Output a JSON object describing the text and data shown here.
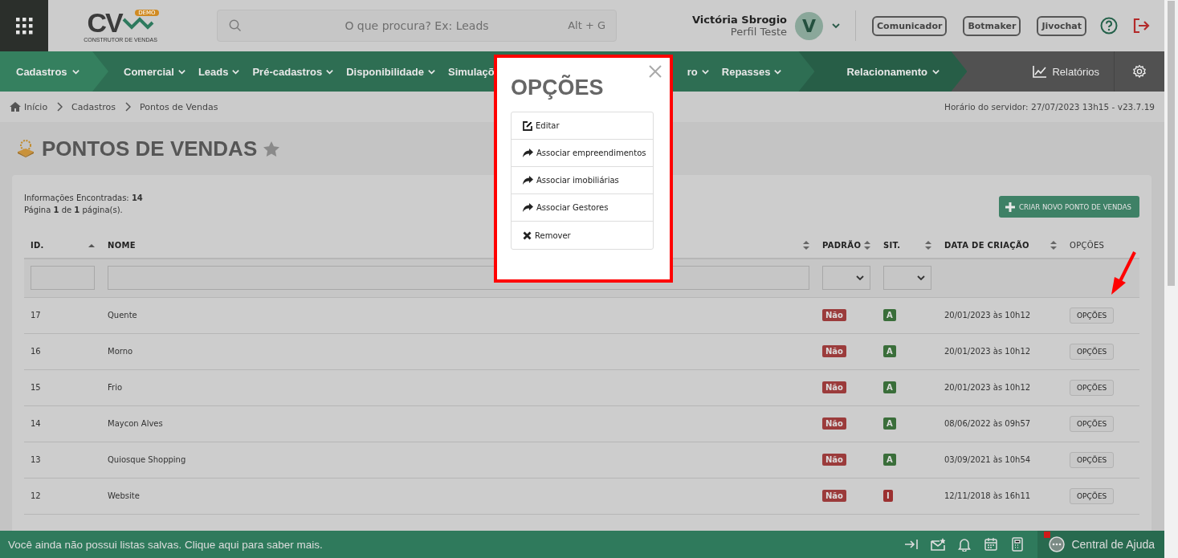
{
  "header": {
    "logo": {
      "mark": "CV",
      "badge": "DEMO",
      "tagline": "CONSTRUTOR DE VENDAS"
    },
    "search": {
      "placeholder": "O que procura? Ex: Leads",
      "shortcut": "Alt + G"
    },
    "user": {
      "name": "Victória Sbrogio",
      "profile": "Perfil Teste",
      "initial": "V"
    },
    "buttons": [
      "Comunicador",
      "Botmaker",
      "Jivochat"
    ]
  },
  "nav": {
    "items": [
      {
        "label": "Cadastros",
        "kind": "section"
      },
      {
        "label": "Comercial",
        "kind": "item"
      },
      {
        "label": "Leads",
        "kind": "item"
      },
      {
        "label": "Pré-cadastros",
        "kind": "item"
      },
      {
        "label": "Disponibilidade",
        "kind": "item"
      },
      {
        "label": "Simulaçõ",
        "kind": "covered-left"
      },
      {
        "label": "ro",
        "kind": "covered-right"
      },
      {
        "label": "Repasses",
        "kind": "item"
      },
      {
        "label": "Relacionamento",
        "kind": "section-dark"
      }
    ],
    "reports": "Relatórios"
  },
  "breadcrumb": [
    "Início",
    "Cadastros",
    "Pontos de Vendas"
  ],
  "server_time": "Horário do servidor: 27/07/2023 13h15 - v23.7.19",
  "page_title": "PONTOS DE VENDAS",
  "summary": [
    "Informações Encontradas: **14**",
    "Página **1** de **1** página(s)."
  ],
  "create_button": "CRIAR NOVO PONTO DE VENDAS",
  "table": {
    "columns": [
      {
        "label": "ID.",
        "sortable": true,
        "sorted": true
      },
      {
        "label": "NOME",
        "sortable": true,
        "sorted": false
      },
      {
        "label": "PADRÃO",
        "sortable": true,
        "sorted": false
      },
      {
        "label": "SIT.",
        "sortable": true,
        "sorted": false
      },
      {
        "label": "DATA DE CRIAÇÃO",
        "sortable": true,
        "sorted": false
      },
      {
        "label": "OPÇÕES",
        "sortable": false
      }
    ],
    "filters": [
      {
        "kind": "text"
      },
      {
        "kind": "text"
      },
      {
        "kind": "select"
      },
      {
        "kind": "select"
      },
      {
        "kind": "empty"
      },
      {
        "kind": "empty"
      }
    ],
    "rows": [
      {
        "id": "17",
        "name": "Quente",
        "default": "Não",
        "status": {
          "label": "A",
          "color": "#3a6e3a"
        },
        "created": "20/01/2023 às 10h12",
        "options": "OPÇÕES"
      },
      {
        "id": "16",
        "name": "Morno",
        "default": "Não",
        "status": {
          "label": "A",
          "color": "#3a6e3a"
        },
        "created": "20/01/2023 às 10h12",
        "options": "OPÇÕES"
      },
      {
        "id": "15",
        "name": "Frio",
        "default": "Não",
        "status": {
          "label": "A",
          "color": "#3a6e3a"
        },
        "created": "20/01/2023 às 10h12",
        "options": "OPÇÕES"
      },
      {
        "id": "14",
        "name": "Maycon Alves",
        "default": "Não",
        "status": {
          "label": "A",
          "color": "#3a6e3a"
        },
        "created": "08/06/2022 às 09h57",
        "options": "OPÇÕES"
      },
      {
        "id": "13",
        "name": "Quiosque Shopping",
        "default": "Não",
        "status": {
          "label": "A",
          "color": "#3a6e3a"
        },
        "created": "03/09/2021 às 10h54",
        "options": "OPÇÕES"
      },
      {
        "id": "12",
        "name": "Website",
        "default": "Não",
        "status": {
          "label": "I",
          "color": "#9b3030"
        },
        "created": "12/11/2018 às 16h11",
        "options": "OPÇÕES"
      }
    ]
  },
  "modal": {
    "title": "OPÇÕES",
    "items": [
      {
        "label": "Editar",
        "kind": "edit"
      },
      {
        "label": "Associar empreendimentos",
        "kind": "share"
      },
      {
        "label": "Associar imobiliárias",
        "kind": "share"
      },
      {
        "label": "Associar Gestores",
        "kind": "share"
      },
      {
        "label": "Remover",
        "kind": "remove"
      }
    ]
  },
  "footer": {
    "message": "Você ainda não possui listas salvas. Clique aqui para saber mais.",
    "help": "Central de Ajuda",
    "help_notification": true
  }
}
